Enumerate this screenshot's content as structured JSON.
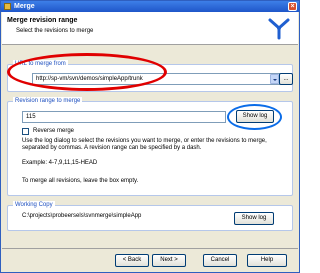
{
  "window": {
    "title": "Merge"
  },
  "header": {
    "title": "Merge revision range",
    "subtitle": "Select the revisions to merge"
  },
  "url_group": {
    "legend": "URL to merge from",
    "url_value": "http://sp-vm/svn/demos/simpleApp/trunk",
    "browse_label": "..."
  },
  "revision_group": {
    "legend": "Revision range to merge",
    "range_value": "115",
    "show_log_label": "Show log",
    "reverse_label": "Reverse merge",
    "reverse_checked": false,
    "help_text": "Use the log dialog to select the revisions you want to merge, or enter the revisions to merge, separated by commas. A revision range can be specified by a dash.",
    "example_text": "Example: 4-7,9,11,15-HEAD",
    "all_text": "To merge all revisions, leave the box empty."
  },
  "working_copy_group": {
    "legend": "Working Copy",
    "path": "C:\\projects\\probeersels\\svnmerge\\simpleApp",
    "show_log_label": "Show log"
  },
  "footer": {
    "back_label": "< Back",
    "next_label": "Next >",
    "cancel_label": "Cancel",
    "help_label": "Help"
  },
  "colors": {
    "title_bar": "#1f56c9",
    "legend_text": "#1d4fbf",
    "highlight_red": "#e00000",
    "highlight_blue": "#0a6ce8"
  },
  "icons": {
    "window_icon": "merge-icon",
    "header_logo": "tortoisesvn-logo-icon"
  }
}
